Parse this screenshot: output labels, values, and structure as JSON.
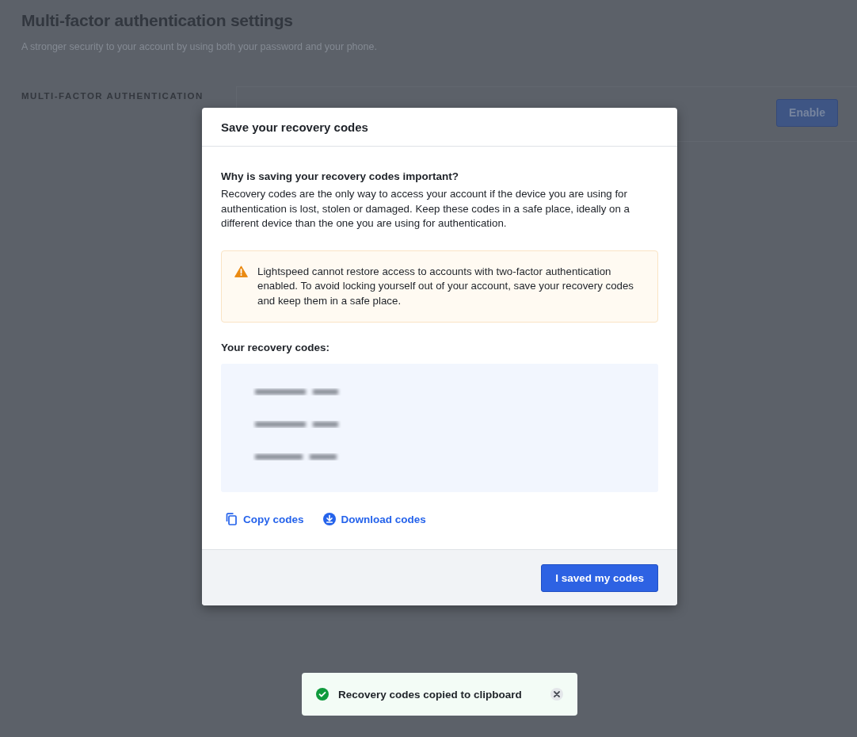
{
  "page": {
    "title": "Multi-factor authentication settings",
    "subtitle": "A stronger security to your account by using both your password and your phone.",
    "section_label": "MULTI-FACTOR AUTHENTICATION",
    "enable_button": "Enable"
  },
  "dialog": {
    "title": "Save your recovery codes",
    "heading": "Why is saving your recovery codes important?",
    "body": "Recovery codes are the only way to access your account if the device you are using for authentication is lost, stolen or damaged. Keep these codes in a safe place, ideally on a different device than the one you are using for authentication.",
    "warning": "Lightspeed cannot restore access to accounts with two-factor authentication enabled. To avoid locking yourself out of your account, save your recovery codes and keep them in a safe place.",
    "codes_label": "Your recovery codes:",
    "actions": [
      {
        "kind": "copy",
        "label": "Copy codes"
      },
      {
        "kind": "download",
        "label": "Download codes"
      }
    ],
    "confirm_button": "I saved my codes"
  },
  "toast": {
    "message": "Recovery codes copied to clipboard"
  }
}
